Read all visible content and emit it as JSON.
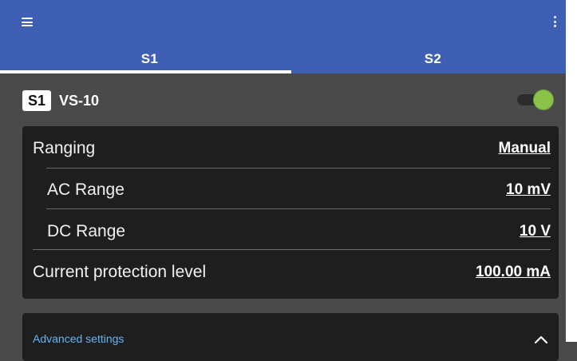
{
  "toolbar": {
    "menu_icon": "menu-icon",
    "more_icon": "more-vert-icon",
    "color": "#3f5fb5"
  },
  "tabs": [
    {
      "label": "S1",
      "selected": true
    },
    {
      "label": "S2",
      "selected": false
    }
  ],
  "device": {
    "badge": "S1",
    "name": "VS-10",
    "enabled": true,
    "toggle_color": "#8bc34a"
  },
  "settings": {
    "ranging": {
      "label": "Ranging",
      "value": "Manual"
    },
    "ac_range": {
      "label": "AC Range",
      "value": "10 mV"
    },
    "dc_range": {
      "label": "DC Range",
      "value": "10 V"
    },
    "current_protection": {
      "label": "Current protection level",
      "value": "100.00 mA"
    }
  },
  "advanced": {
    "label": "Advanced settings",
    "expanded": true,
    "link_color": "#64b5f6"
  }
}
